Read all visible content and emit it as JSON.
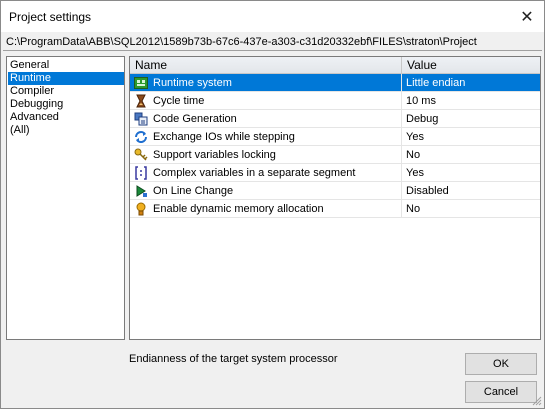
{
  "window": {
    "title": "Project settings",
    "close_glyph": "✕"
  },
  "path": "C:\\ProgramData\\ABB\\SQL2012\\1589b73b-67c6-437e-a303-c31d20332ebf\\FILES\\straton\\Project",
  "categories": [
    {
      "label": "General",
      "selected": false
    },
    {
      "label": "Runtime",
      "selected": true
    },
    {
      "label": "Compiler",
      "selected": false
    },
    {
      "label": "Debugging",
      "selected": false
    },
    {
      "label": "Advanced",
      "selected": false
    },
    {
      "label": "(All)",
      "selected": false
    }
  ],
  "grid": {
    "header_name": "Name",
    "header_value": "Value",
    "rows": [
      {
        "name": "Runtime system",
        "value": "Little endian",
        "icon": "runtime-system-icon",
        "selected": true
      },
      {
        "name": "Cycle time",
        "value": "10 ms",
        "icon": "cycle-time-icon"
      },
      {
        "name": "Code Generation",
        "value": "Debug",
        "icon": "code-generation-icon"
      },
      {
        "name": "Exchange IOs while stepping",
        "value": "Yes",
        "icon": "exchange-ios-icon"
      },
      {
        "name": "Support variables locking",
        "value": "No",
        "icon": "lock-icon"
      },
      {
        "name": "Complex variables in a separate segment",
        "value": "Yes",
        "icon": "brackets-icon"
      },
      {
        "name": "On Line Change",
        "value": "Disabled",
        "icon": "online-change-icon"
      },
      {
        "name": "Enable dynamic memory allocation",
        "value": "No",
        "icon": "memory-icon"
      }
    ]
  },
  "description": "Endianness of the target system processor",
  "buttons": {
    "ok": "OK",
    "cancel": "Cancel"
  },
  "colors": {
    "selection": "#0078d7"
  }
}
